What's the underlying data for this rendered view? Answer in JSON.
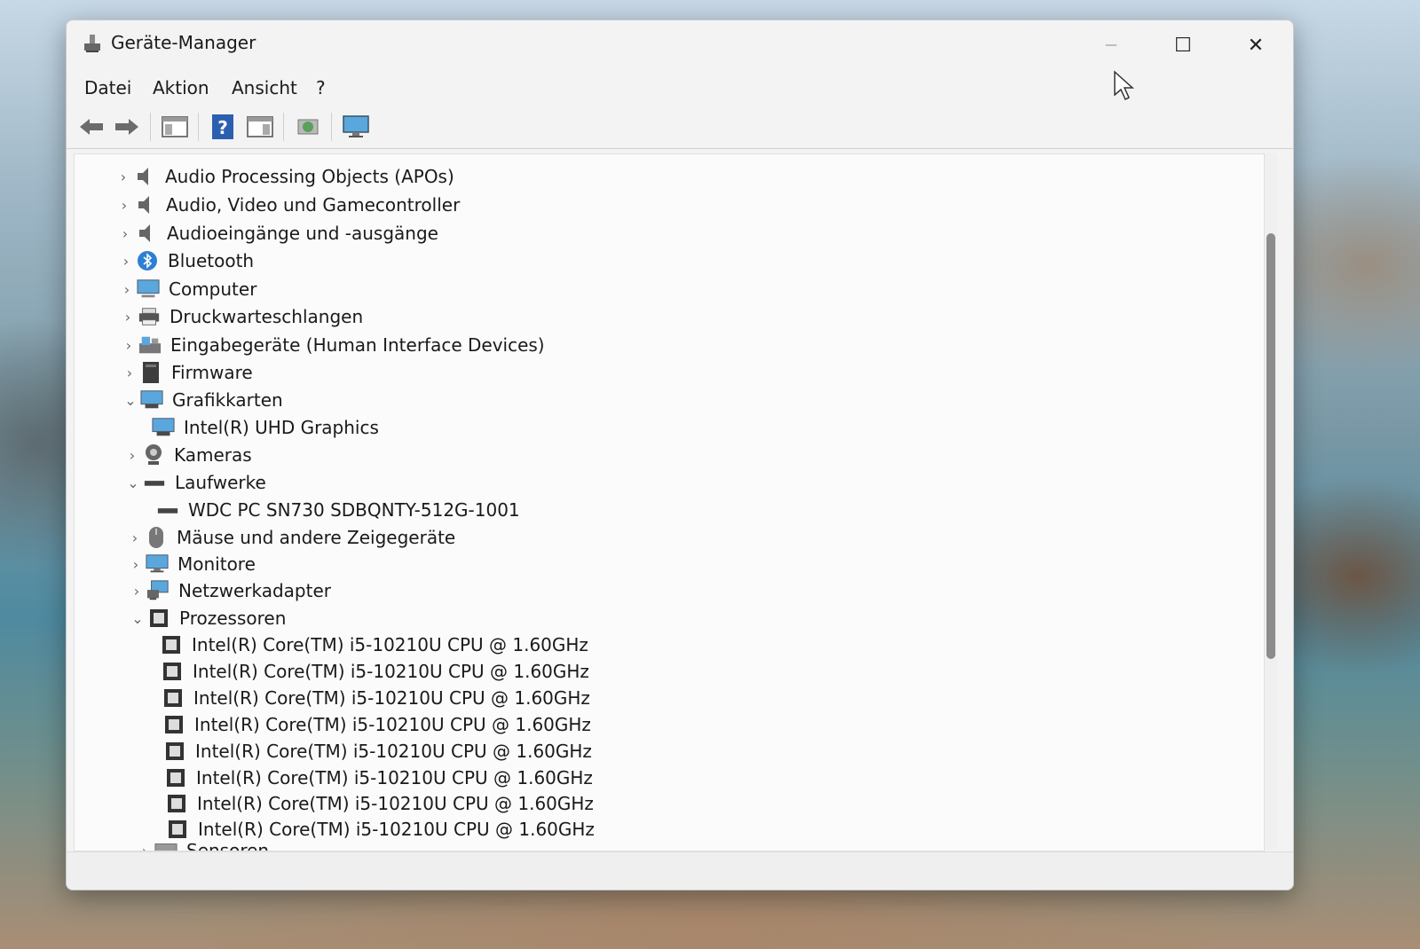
{
  "window": {
    "title": "Geräte-Manager",
    "minimize_glyph": "—",
    "maximize_glyph": "☐",
    "close_glyph": "✕"
  },
  "menu": {
    "items": [
      "Datei",
      "Aktion",
      "Ansicht",
      "?"
    ]
  },
  "toolbar": {
    "buttons": [
      "back-arrow-icon",
      "forward-arrow-icon",
      "properties-panel-icon",
      "help-icon",
      "view-icon",
      "update-driver-icon",
      "monitor-icon"
    ]
  },
  "tree": {
    "nodes": [
      {
        "label": "Audio Processing Objects (APOs)",
        "expanded": false,
        "icon": "speaker-icon"
      },
      {
        "label": "Audio, Video und Gamecontroller",
        "expanded": false,
        "icon": "speaker-icon"
      },
      {
        "label": "Audioeingänge und -ausgänge",
        "expanded": false,
        "icon": "speaker-icon"
      },
      {
        "label": "Bluetooth",
        "expanded": false,
        "icon": "bluetooth-icon"
      },
      {
        "label": "Computer",
        "expanded": false,
        "icon": "computer-icon"
      },
      {
        "label": "Druckwarteschlangen",
        "expanded": false,
        "icon": "printer-icon"
      },
      {
        "label": "Eingabegeräte (Human Interface Devices)",
        "expanded": false,
        "icon": "hid-icon"
      },
      {
        "label": "Firmware",
        "expanded": false,
        "icon": "firmware-icon"
      },
      {
        "label": "Grafikkarten",
        "expanded": true,
        "icon": "display-adapter-icon"
      },
      {
        "label": "Intel(R) UHD Graphics",
        "child": true,
        "icon": "display-adapter-icon"
      },
      {
        "label": "Kameras",
        "expanded": false,
        "icon": "camera-icon"
      },
      {
        "label": "Laufwerke",
        "expanded": true,
        "icon": "drive-icon"
      },
      {
        "label": "WDC PC SN730 SDBQNTY-512G-1001",
        "child": true,
        "icon": "drive-icon"
      },
      {
        "label": "Mäuse und andere Zeigegeräte",
        "expanded": false,
        "icon": "mouse-icon"
      },
      {
        "label": "Monitore",
        "expanded": false,
        "icon": "monitor-icon"
      },
      {
        "label": "Netzwerkadapter",
        "expanded": false,
        "icon": "network-adapter-icon"
      },
      {
        "label": "Prozessoren",
        "expanded": true,
        "icon": "processor-icon"
      },
      {
        "label": "Intel(R) Core(TM) i5-10210U CPU @ 1.60GHz",
        "child": true,
        "icon": "processor-icon"
      },
      {
        "label": "Intel(R) Core(TM) i5-10210U CPU @ 1.60GHz",
        "child": true,
        "icon": "processor-icon"
      },
      {
        "label": "Intel(R) Core(TM) i5-10210U CPU @ 1.60GHz",
        "child": true,
        "icon": "processor-icon"
      },
      {
        "label": "Intel(R) Core(TM) i5-10210U CPU @ 1.60GHz",
        "child": true,
        "icon": "processor-icon"
      },
      {
        "label": "Intel(R) Core(TM) i5-10210U CPU @ 1.60GHz",
        "child": true,
        "icon": "processor-icon"
      },
      {
        "label": "Intel(R) Core(TM) i5-10210U CPU @ 1.60GHz",
        "child": true,
        "icon": "processor-icon"
      },
      {
        "label": "Intel(R) Core(TM) i5-10210U CPU @ 1.60GHz",
        "child": true,
        "icon": "processor-icon"
      },
      {
        "label": "Intel(R) Core(TM) i5-10210U CPU @ 1.60GHz",
        "child": true,
        "icon": "processor-icon"
      },
      {
        "label": "Sensoren",
        "expanded": false,
        "icon": "sensor-icon"
      }
    ]
  },
  "colors": {
    "accent": "#2d7fd3",
    "icon_gray": "#555555"
  }
}
